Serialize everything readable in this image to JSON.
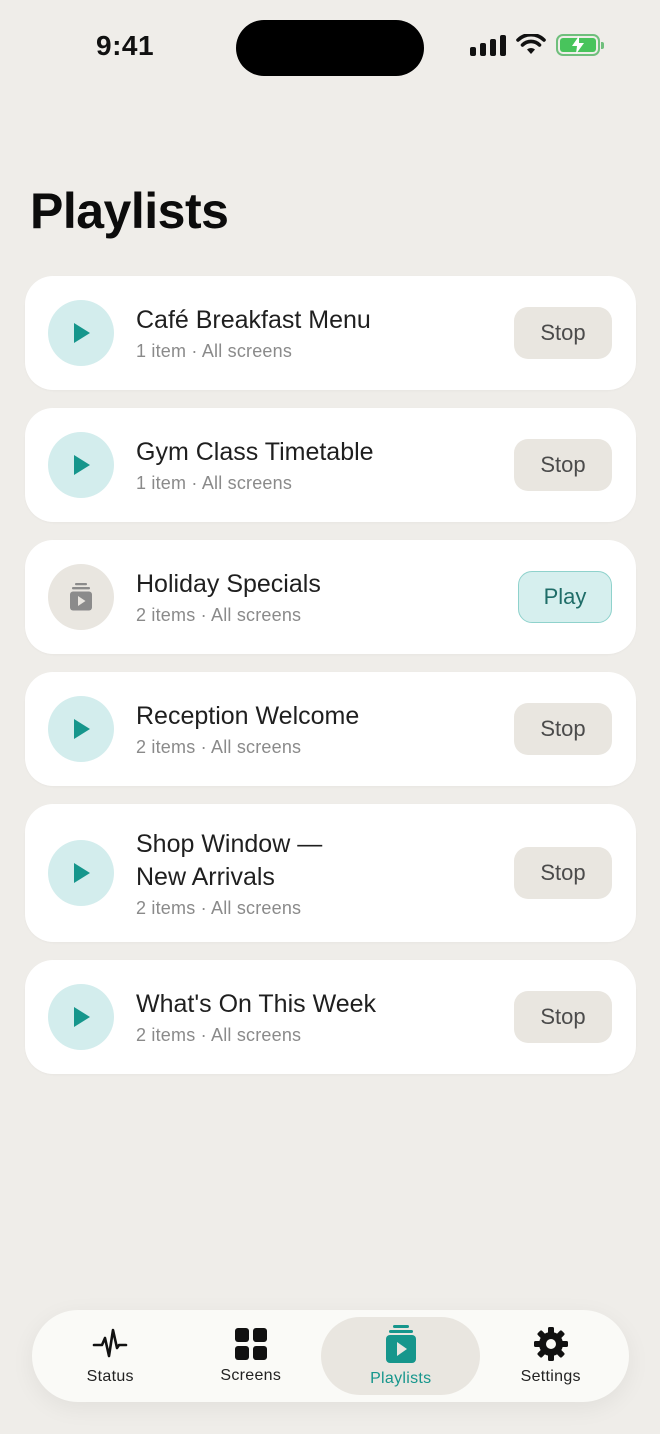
{
  "status_bar": {
    "time": "9:41"
  },
  "page": {
    "title": "Playlists"
  },
  "playlists": [
    {
      "title": "Café Breakfast Menu",
      "subtitle": "1 item · All screens",
      "state": "playing",
      "action": "Stop"
    },
    {
      "title": "Gym Class Timetable",
      "subtitle": "1 item · All screens",
      "state": "playing",
      "action": "Stop"
    },
    {
      "title": "Holiday Specials",
      "subtitle": "2 items · All screens",
      "state": "idle",
      "action": "Play"
    },
    {
      "title": "Reception Welcome",
      "subtitle": "2 items · All screens",
      "state": "playing",
      "action": "Stop"
    },
    {
      "title_line1": "Shop Window —",
      "title_line2": "New Arrivals",
      "subtitle": "2 items · All screens",
      "state": "playing",
      "action": "Stop"
    },
    {
      "title": "What's On This Week",
      "subtitle": "2 items · All screens",
      "state": "playing",
      "action": "Stop"
    }
  ],
  "tab_bar": {
    "active": "Playlists",
    "tabs": [
      {
        "label": "Status",
        "icon": "pulse-icon"
      },
      {
        "label": "Screens",
        "icon": "grid-icon"
      },
      {
        "label": "Playlists",
        "icon": "playlist-icon"
      },
      {
        "label": "Settings",
        "icon": "gear-icon"
      }
    ]
  },
  "colors": {
    "accent": "#16968c",
    "background": "#efede9",
    "playing_circle": "#d3eded",
    "idle_circle": "#e9e6e0"
  }
}
